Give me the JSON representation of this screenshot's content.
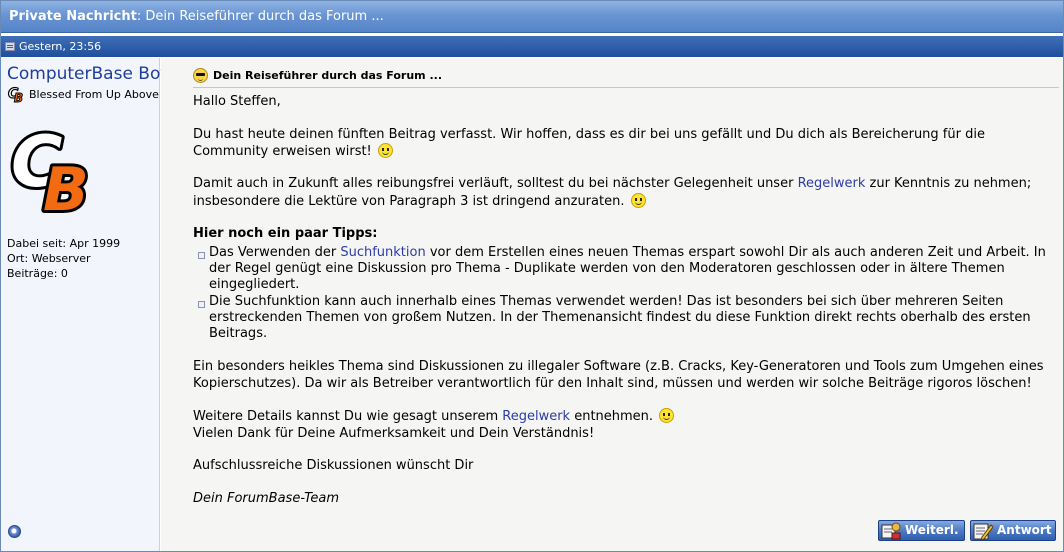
{
  "titlebar": {
    "prefix": "Private Nachricht",
    "subject": ": Dein Reiseführer durch das Forum ..."
  },
  "datebar": {
    "date": "Gestern, 23:56",
    "icon": "post-icon"
  },
  "user": {
    "name": "ComputerBase Bot",
    "title": "Blessed From Up Above",
    "rank_icon": "cb-logo-icon",
    "avatar": "cb-logo",
    "joined": "Dabei seit: Apr 1999",
    "location": "Ort: Webserver",
    "posts": "Beiträge: 0",
    "status_icon": "online-status-icon"
  },
  "message": {
    "subject_icon": "cool-smiley-icon",
    "subject": "Dein Reiseführer durch das Forum ...",
    "greeting": "Hallo Steffen,",
    "p1": "Du hast heute deinen fünften Beitrag verfasst. Wir hoffen, dass es dir bei uns gefällt und Du dich als Bereicherung für die Community erweisen wirst!",
    "p2_before": "Damit auch in Zukunft alles reibungsfrei verläuft, solltest du bei nächster Gelegenheit unser ",
    "p2_link": "Regelwerk",
    "p2_after": " zur Kenntnis zu nehmen; insbesondere die Lektüre von Paragraph 3 ist dringend anzuraten.",
    "tips_heading": "Hier noch ein paar Tipps:",
    "tip1_before": "Das Verwenden der ",
    "tip1_link": "Suchfunktion",
    "tip1_after": " vor dem Erstellen eines neuen Themas erspart sowohl Dir als auch anderen Zeit und Arbeit. In der Regel genügt eine Diskussion pro Thema - Duplikate werden von den Moderatoren geschlossen oder in ältere Themen eingegliedert.",
    "tip2": "Die Suchfunktion kann auch innerhalb eines Themas verwendet werden! Das ist besonders bei sich über mehreren Seiten erstreckenden Themen von großem Nutzen. In der Themenansicht findest du diese Funktion direkt rechts oberhalb des ersten Beitrags.",
    "p3": "Ein besonders heikles Thema sind Diskussionen zu illegaler Software (z.B. Cracks, Key-Generatoren und Tools zum Umgehen eines Kopierschutzes). Da wir als Betreiber verantwortlich für den Inhalt sind, müssen und werden wir solche Beiträge rigoros löschen!",
    "p4_before": "Weitere Details kannst Du wie gesagt unserem ",
    "p4_link": "Regelwerk",
    "p4_after": " entnehmen.",
    "p4_line2": "Vielen Dank für Deine Aufmerksamkeit und Dein Verständnis!",
    "closing": "Aufschlussreiche Diskussionen wünscht Dir",
    "signature": "Dein ForumBase-Team"
  },
  "buttons": {
    "forward": "Weiterl.",
    "forward_icon": "forward-message-icon",
    "reply": "Antwort",
    "reply_icon": "reply-pencil-icon"
  }
}
